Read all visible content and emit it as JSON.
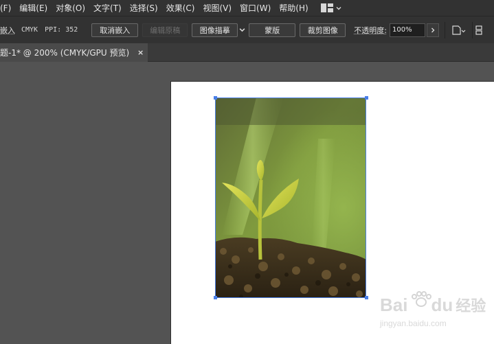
{
  "menubar": {
    "items": [
      {
        "label": "(F)"
      },
      {
        "label": "编辑(E)"
      },
      {
        "label": "对象(O)"
      },
      {
        "label": "文字(T)"
      },
      {
        "label": "选择(S)"
      },
      {
        "label": "效果(C)"
      },
      {
        "label": "视图(V)"
      },
      {
        "label": "窗口(W)"
      },
      {
        "label": "帮助(H)"
      }
    ]
  },
  "controlbar": {
    "embed_label": "嵌入",
    "color_mode": "CMYK",
    "ppi_label": "PPI: 352",
    "unembed_button": "取消嵌入",
    "edit_original_button": "编辑原稿",
    "image_trace_button": "图像描摹",
    "mask_button": "蒙版",
    "crop_button": "裁剪图像",
    "opacity_label": "不透明度:",
    "opacity_value": "100%"
  },
  "document_tab": {
    "title": "题-1* @ 200% (CMYK/GPU 预览)",
    "close": "×"
  },
  "watermark": {
    "brand_left": "Bai",
    "brand_right": "du",
    "brand_cn": "经验",
    "url": "jingyan.baidu.com"
  },
  "colors": {
    "menubar_bg": "#323232",
    "canvas_bg": "#535353",
    "selection": "#4a7fe8"
  }
}
